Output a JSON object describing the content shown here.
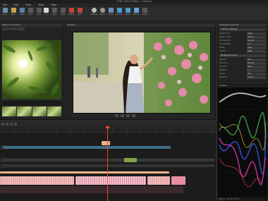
{
  "window": {
    "title": "VSDC Video Editor – Untitled"
  },
  "menu": [
    "File",
    "Edit",
    "View",
    "Tools",
    "Help"
  ],
  "toolbar": {
    "groups": [
      {
        "name": "project",
        "items": [
          "New",
          "Open",
          "Save",
          "Undo",
          "Redo"
        ]
      },
      {
        "name": "editing",
        "items": [
          "Cut",
          "Copy",
          "Paste",
          "Delete",
          "Split"
        ]
      },
      {
        "name": "tools",
        "items": [
          "Settings",
          "Search",
          "Export",
          "Preview",
          "Filters",
          "Effects",
          "Output"
        ]
      }
    ]
  },
  "left_panel": {
    "title": "Resource window"
  },
  "preview_panel": {
    "title": "Preview"
  },
  "properties": {
    "title": "Properties window",
    "section1": "Common settings",
    "section2": "Background video",
    "rows": [
      {
        "key": "Object type",
        "value": "Video"
      },
      {
        "key": "Object name",
        "value": "Video 1"
      },
      {
        "key": "Composition",
        "value": "Normal"
      },
      {
        "key": "Coordinates",
        "value": "0; 0"
      },
      {
        "key": "Width",
        "value": "1920"
      },
      {
        "key": "Height",
        "value": "1080"
      },
      {
        "key": "Opacity",
        "value": "100"
      },
      {
        "key": "Blending",
        "value": "Normal"
      },
      {
        "key": "Fill color",
        "value": "Black"
      },
      {
        "key": "Rotation",
        "value": "0"
      },
      {
        "key": "Speed",
        "value": "100"
      },
      {
        "key": "Playback",
        "value": "Normal"
      }
    ]
  },
  "scopes": {
    "title": "Scopes"
  },
  "timeline": {
    "title": "Timeline"
  },
  "status": {
    "text": "Position: 00:00:12.431"
  },
  "colors": {
    "accent": "#e43b2b",
    "clip_blue": "#3f6f86",
    "clip_pink": "#e8a7a7",
    "clip_orange": "#e8b48a",
    "clip_green": "#7fa24a"
  }
}
